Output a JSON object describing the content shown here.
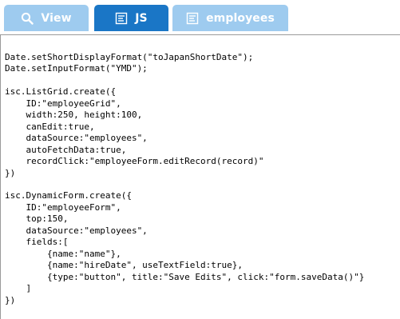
{
  "tabs": [
    {
      "label": "View",
      "icon": "search-icon",
      "active": false
    },
    {
      "label": "JS",
      "icon": "js-file-icon",
      "active": true
    },
    {
      "label": "employees",
      "icon": "datasource-file-icon",
      "active": false
    }
  ],
  "colors": {
    "tab_active": "#1a76c6",
    "tab_inactive": "#9ecbef",
    "tab_text": "#ffffff",
    "code_text": "#000000"
  },
  "code": {
    "lines": [
      "Date.setShortDisplayFormat(\"toJapanShortDate\");",
      "Date.setInputFormat(\"YMD\");",
      "",
      "isc.ListGrid.create({",
      "    ID:\"employeeGrid\",",
      "    width:250, height:100,",
      "    canEdit:true,",
      "    dataSource:\"employees\",",
      "    autoFetchData:true,",
      "    recordClick:\"employeeForm.editRecord(record)\"",
      "})",
      "",
      "isc.DynamicForm.create({",
      "    ID:\"employeeForm\",",
      "    top:150,",
      "    dataSource:\"employees\",",
      "    fields:[",
      "        {name:\"name\"},",
      "        {name:\"hireDate\", useTextField:true},",
      "        {type:\"button\", title:\"Save Edits\", click:\"form.saveData()\"}",
      "    ]",
      "})"
    ]
  }
}
